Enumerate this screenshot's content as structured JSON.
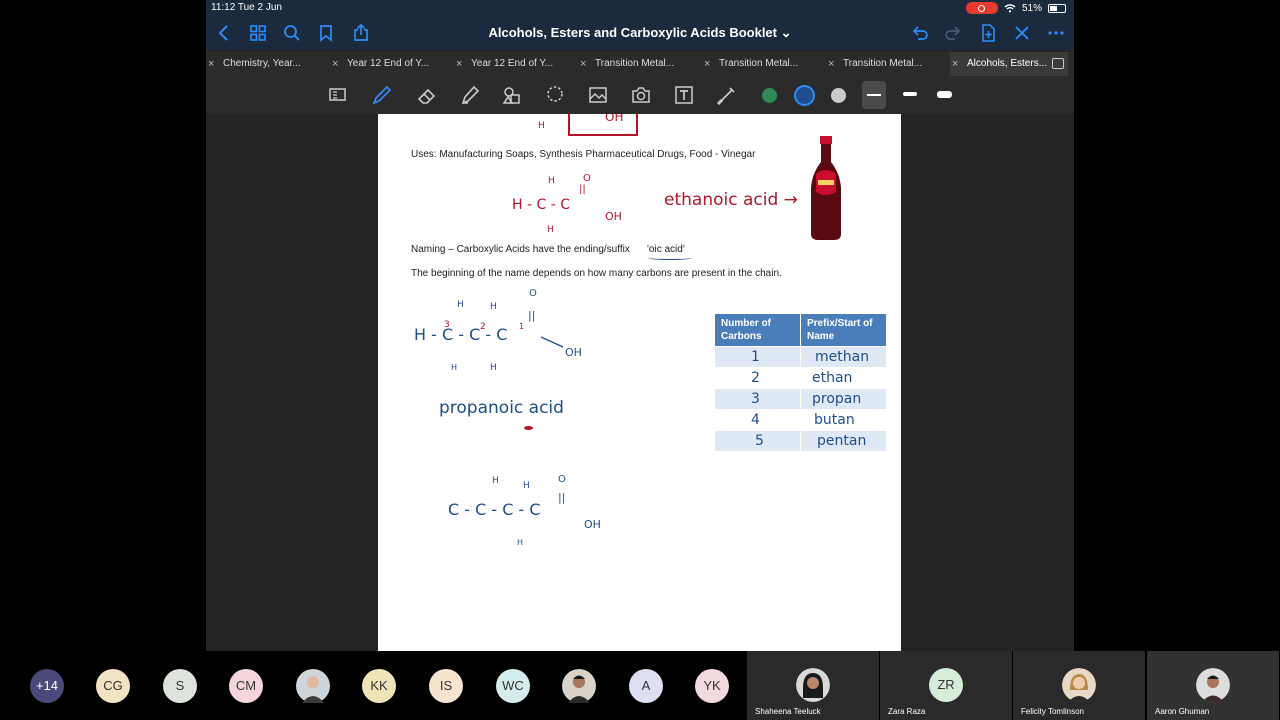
{
  "status": {
    "time_date": "11:12   Tue 2 Jun",
    "battery": "51%"
  },
  "header": {
    "title": "Alcohols, Esters and Carboxylic Acids Booklet ⌄"
  },
  "tabs": [
    {
      "label": "Chemistry, Year..."
    },
    {
      "label": "Year 12 End of Y..."
    },
    {
      "label": "Year 12 End of Y..."
    },
    {
      "label": "Transition Metal..."
    },
    {
      "label": "Transition Metal..."
    },
    {
      "label": "Transition Metal..."
    },
    {
      "label": "Alcohols, Esters..."
    }
  ],
  "colors": {
    "accent": "#2f8cf6",
    "status_bar": "#1c2a3e",
    "ink_red": "#b3162a",
    "ink_blue": "#1f4e8c",
    "table_header": "#4a7ebb"
  },
  "page": {
    "uses": "Uses: Manufacturing Soaps, Synthesis Pharmaceutical Drugs, Food - Vinegar",
    "naming": "Naming – Carboxylic Acids have the ending/suffix",
    "suffix": "'oic acid'",
    "beginning": "The beginning of the name depends on how many carbons are present in the chain.",
    "handwriting": {
      "top_oh": "OH",
      "top_h": "H",
      "ethanoic": "ethanoic acid →",
      "f1": {
        "h_top": "H",
        "o": "O",
        "dbl": "||",
        "chain": "H -  C - C",
        "oh": "OH",
        "h_bot": "H"
      },
      "f2": {
        "o": "O",
        "h1": "H",
        "h2": "H",
        "dbl": "||",
        "chain": "H - C - C - C",
        "n3": "3",
        "n2": "2",
        "n1": "1",
        "oh": "OH",
        "hb1": "H",
        "hb2": "H"
      },
      "propanoic": "propanoic  acid",
      "f3": {
        "o": "O",
        "h1": "H",
        "h2": "H",
        "dbl": "||",
        "chain": "C - C - C - C",
        "oh": "OH",
        "h_bot": "H"
      }
    },
    "table": {
      "headers": [
        "Number of Carbons",
        "Prefix/Start of Name"
      ],
      "rows": [
        {
          "n": "1",
          "prefix": "methan"
        },
        {
          "n": "2",
          "prefix": "ethan"
        },
        {
          "n": "3",
          "prefix": "propan"
        },
        {
          "n": "4",
          "prefix": "butan"
        },
        {
          "n": "5",
          "prefix": "pentan"
        }
      ]
    }
  },
  "participants": {
    "more": "+14",
    "initials": [
      {
        "label": "CG",
        "color": "#f1e3c3"
      },
      {
        "label": "S",
        "color": "#dfe3dd"
      },
      {
        "label": "CM",
        "color": "#f7d5dc"
      },
      {
        "label": "KK",
        "color": "#f1e3b8"
      },
      {
        "label": "IS",
        "color": "#f6e4cf"
      },
      {
        "label": "WC",
        "color": "#d5ecec"
      },
      {
        "label": "A",
        "color": "#dfdff3"
      },
      {
        "label": "YK",
        "color": "#f3dadf"
      }
    ],
    "tiles": [
      {
        "name": "Shaheena Teeluck"
      },
      {
        "name": "Zara Raza",
        "initials": "ZR"
      },
      {
        "name": "Felicity Tomlinson"
      },
      {
        "name": "Aaron Ghuman"
      }
    ]
  }
}
